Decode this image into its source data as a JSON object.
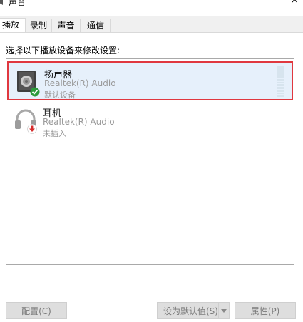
{
  "window": {
    "title": "声音",
    "icon": "speaker-icon",
    "close": "×"
  },
  "tabs": [
    {
      "label": "播放",
      "active": true
    },
    {
      "label": "录制",
      "active": false
    },
    {
      "label": "声音",
      "active": false
    },
    {
      "label": "通信",
      "active": false
    }
  ],
  "instruction": "选择以下播放设备来修改设置:",
  "devices": [
    {
      "name": "扬声器",
      "driver": "Realtek(R) Audio",
      "status": "默认设备",
      "icon": "speaker-device-icon",
      "badge": "default-check-icon",
      "selected": true
    },
    {
      "name": "耳机",
      "driver": "Realtek(R) Audio",
      "status": "未插入",
      "icon": "headphones-device-icon",
      "badge": "unplugged-arrow-icon",
      "selected": false
    }
  ],
  "buttons": {
    "configure": "配置(C)",
    "set_default": "设为默认值(S)",
    "properties": "属性(P)"
  },
  "colors": {
    "selection_border": "#e0383f",
    "selection_bg": "#e6f0fb",
    "default_badge": "#2d9a3c",
    "unplugged_badge": "#d62b2b"
  }
}
